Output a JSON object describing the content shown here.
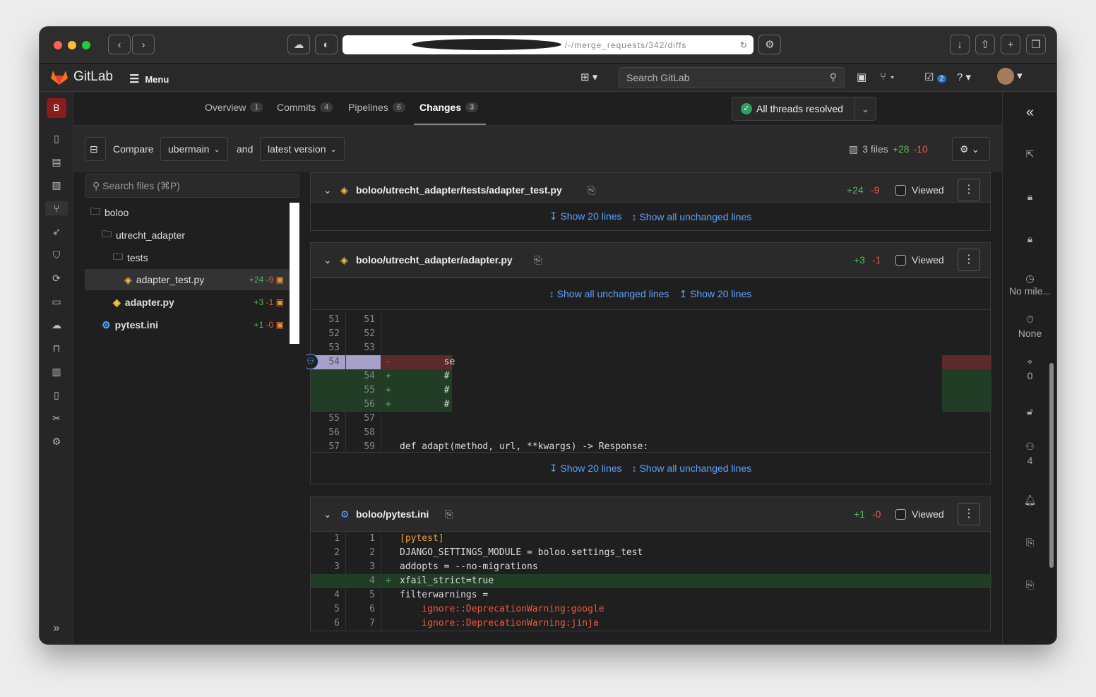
{
  "browser": {
    "url": "/-/merge_requests/342/diffs"
  },
  "topnav": {
    "brand": "GitLab",
    "menu_label": "Menu",
    "search_placeholder": "Search GitLab",
    "todo_count": "2"
  },
  "sidebar": {
    "project_letter": "B"
  },
  "tabs": [
    {
      "label": "Overview",
      "count": "1"
    },
    {
      "label": "Commits",
      "count": "4"
    },
    {
      "label": "Pipelines",
      "count": "6"
    },
    {
      "label": "Changes",
      "count": "3"
    }
  ],
  "threads_status": "All threads resolved",
  "compare": {
    "label": "Compare",
    "source": "ubermain",
    "and_label": "and",
    "target": "latest version",
    "files_summary": "3 files",
    "additions": "+28",
    "deletions": "-10"
  },
  "filetree": {
    "search_placeholder": "Search files (⌘P)",
    "folder_root": "boloo",
    "folder_adapter": "utrecht_adapter",
    "folder_tests": "tests",
    "file1": {
      "name": "adapter_test.py",
      "add": "+24",
      "del": "-9"
    },
    "file2": {
      "name": "adapter.py",
      "add": "+3",
      "del": "-1"
    },
    "file3": {
      "name": "pytest.ini",
      "add": "+1",
      "del": "-0"
    }
  },
  "diff1": {
    "path": "boloo/utrecht_adapter/tests/adapter_test.py",
    "add": "+24",
    "del": "-9",
    "viewed": "Viewed",
    "show20": "Show 20 lines",
    "showall": "Show all unchanged lines"
  },
  "diff2": {
    "path": "boloo/utrecht_adapter/adapter.py",
    "add": "+3",
    "del": "-1",
    "viewed": "Viewed",
    "showall": "Show all unchanged lines",
    "show20": "Show 20 lines",
    "lines": [
      {
        "o": "51",
        "n": "51",
        "s": "",
        "t": ""
      },
      {
        "o": "52",
        "n": "52",
        "s": "",
        "t": ""
      },
      {
        "o": "53",
        "n": "53",
        "s": "",
        "t": ""
      },
      {
        "o": "54",
        "n": "",
        "s": "-",
        "t": "        se"
      },
      {
        "o": "",
        "n": "54",
        "s": "+",
        "t": "        #"
      },
      {
        "o": "",
        "n": "55",
        "s": "+",
        "t": "        #"
      },
      {
        "o": "",
        "n": "56",
        "s": "+",
        "t": "        #"
      },
      {
        "o": "55",
        "n": "57",
        "s": "",
        "t": ""
      },
      {
        "o": "56",
        "n": "58",
        "s": "",
        "t": ""
      },
      {
        "o": "57",
        "n": "59",
        "s": "",
        "t": "def adapt(method, url, **kwargs) -> Response:"
      }
    ],
    "show20_b": "Show 20 lines",
    "showall_b": "Show all unchanged lines"
  },
  "diff3": {
    "path": "boloo/pytest.ini",
    "add": "+1",
    "del": "-0",
    "viewed": "Viewed",
    "lines": [
      {
        "o": "1",
        "n": "1",
        "s": "",
        "t": "[pytest]"
      },
      {
        "o": "2",
        "n": "2",
        "s": "",
        "t": "DJANGO_SETTINGS_MODULE = boloo.settings_test"
      },
      {
        "o": "3",
        "n": "3",
        "s": "",
        "t": "addopts = --no-migrations"
      },
      {
        "o": "",
        "n": "4",
        "s": "+",
        "t": "xfail_strict=true"
      },
      {
        "o": "4",
        "n": "5",
        "s": "",
        "t": "filterwarnings ="
      },
      {
        "o": "5",
        "n": "6",
        "s": "",
        "t": "    ignore::DeprecationWarning:google"
      },
      {
        "o": "6",
        "n": "7",
        "s": "",
        "t": "    ignore::DeprecationWarning:jinja"
      }
    ]
  },
  "right_sidebar": {
    "milestone": "No mile...",
    "time": "None",
    "labels": "0",
    "participants": "4"
  },
  "colors": {
    "add": "#52b95b",
    "del": "#ec5941",
    "link": "#5ca1ff",
    "del_bg": "#5c2a2a",
    "add_bg": "#213d26"
  }
}
